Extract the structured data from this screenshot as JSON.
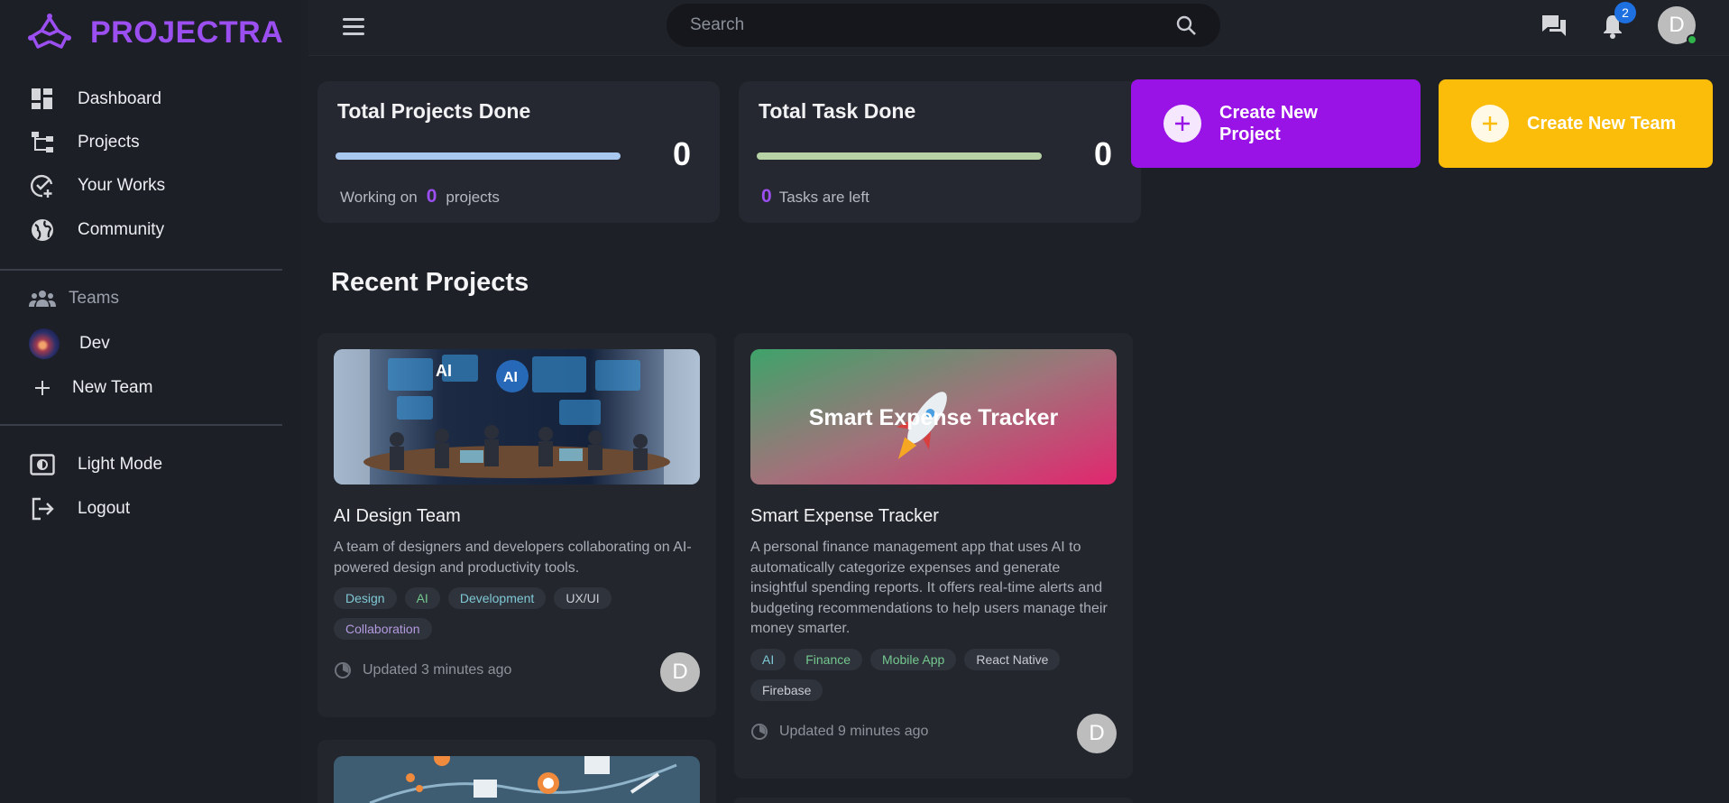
{
  "brand": {
    "name": "PROJECTRA",
    "accent": "#9b4ff0"
  },
  "sidebar": {
    "items": [
      {
        "label": "Dashboard",
        "icon": "dashboard-icon"
      },
      {
        "label": "Projects",
        "icon": "projects-icon"
      },
      {
        "label": "Your Works",
        "icon": "your-works-icon"
      },
      {
        "label": "Community",
        "icon": "globe-icon"
      }
    ],
    "teams_heading": "Teams",
    "teams": [
      {
        "label": "Dev"
      }
    ],
    "new_team": "New Team",
    "light_mode": "Light Mode",
    "logout": "Logout"
  },
  "topbar": {
    "search_placeholder": "Search",
    "notification_count": "2",
    "user_initial": "D"
  },
  "stats": {
    "projects": {
      "title": "Total Projects Done",
      "value": "0",
      "sub_prefix": "Working on",
      "sub_count": "0",
      "sub_suffix": "projects",
      "bar_color": "#a8c8f0",
      "progress": 1.0
    },
    "tasks": {
      "title": "Total Task Done",
      "value": "0",
      "sub_count": "0",
      "sub_suffix": "Tasks are left",
      "bar_color": "#b7d3a5",
      "progress": 1.0
    }
  },
  "actions": {
    "create_project": {
      "label": "Create New Project",
      "color": "#9a13e6"
    },
    "create_team": {
      "label": "Create New Team",
      "color": "#fbbd09"
    }
  },
  "recent": {
    "title": "Recent Projects",
    "projects": [
      {
        "title": "AI Design Team",
        "description": "A team of designers and developers collaborating on AI-powered design and productivity tools.",
        "tags": [
          {
            "label": "Design",
            "color": "#7fc8d6"
          },
          {
            "label": "AI",
            "color": "#74c88f"
          },
          {
            "label": "Development",
            "color": "#7fc8d6"
          },
          {
            "label": "UX/UI",
            "color": "#c9ccd2"
          },
          {
            "label": "Collaboration",
            "color": "#b39ae0"
          }
        ],
        "updated": "Updated 3 minutes ago",
        "owner_initial": "D"
      },
      {
        "title": "Smart Expense Tracker",
        "image_text": "Smart Expense Tracker",
        "description": "A personal finance management app that uses AI to automatically categorize expenses and generate insightful spending reports. It offers real-time alerts and budgeting recommendations to help users manage their money smarter.",
        "tags": [
          {
            "label": "AI",
            "color": "#7fc8d6"
          },
          {
            "label": "Finance",
            "color": "#74c88f"
          },
          {
            "label": "Mobile App",
            "color": "#74c88f"
          },
          {
            "label": "React Native",
            "color": "#c9ccd2"
          },
          {
            "label": "Firebase",
            "color": "#c9ccd2"
          }
        ],
        "updated": "Updated 9 minutes ago",
        "owner_initial": "D"
      }
    ]
  }
}
